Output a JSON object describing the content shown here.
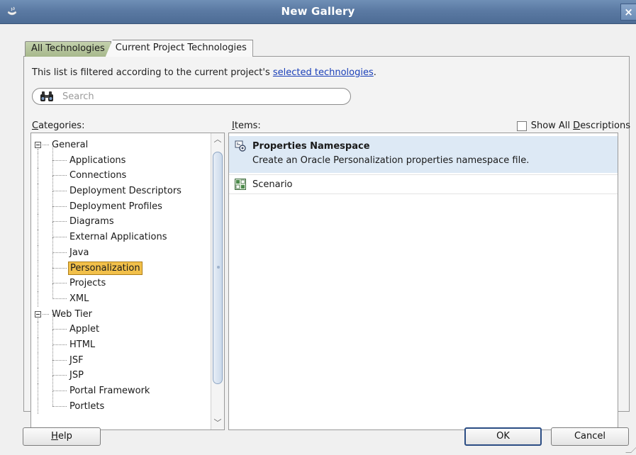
{
  "window": {
    "title": "New Gallery",
    "close_glyph": "×"
  },
  "tabs": [
    {
      "label": "All Technologies",
      "active": false
    },
    {
      "label": "Current Project Technologies",
      "active": true
    }
  ],
  "filter_note": {
    "text": "This list is filtered according to the current project's ",
    "link": "selected technologies",
    "suffix": "."
  },
  "search": {
    "placeholder": "Search",
    "value": "",
    "icon": "binoculars-icon"
  },
  "categories": {
    "label_mnemonic": "C",
    "label_rest": "ategories:",
    "tree": [
      {
        "label": "General",
        "level": 0,
        "expanded": true
      },
      {
        "label": "Applications",
        "level": 1
      },
      {
        "label": "Connections",
        "level": 1
      },
      {
        "label": "Deployment Descriptors",
        "level": 1
      },
      {
        "label": "Deployment Profiles",
        "level": 1
      },
      {
        "label": "Diagrams",
        "level": 1
      },
      {
        "label": "External Applications",
        "level": 1
      },
      {
        "label": "Java",
        "level": 1
      },
      {
        "label": "Personalization",
        "level": 1,
        "selected": true
      },
      {
        "label": "Projects",
        "level": 1
      },
      {
        "label": "XML",
        "level": 1
      },
      {
        "label": "Web Tier",
        "level": 0,
        "expanded": true
      },
      {
        "label": "Applet",
        "level": 1
      },
      {
        "label": "HTML",
        "level": 1
      },
      {
        "label": "JSF",
        "level": 1
      },
      {
        "label": "JSP",
        "level": 1
      },
      {
        "label": "Portal Framework",
        "level": 1
      },
      {
        "label": "Portlets",
        "level": 1
      }
    ]
  },
  "items": {
    "label_mnemonic": "I",
    "label_rest": "tems:",
    "show_all": {
      "before": "Show All ",
      "mnemonic": "D",
      "after": "escriptions",
      "checked": false
    },
    "list": [
      {
        "name": "Properties Namespace",
        "description": "Create an Oracle Personalization properties namespace file.",
        "selected": true,
        "icon": "properties-namespace-icon"
      },
      {
        "name": "Scenario",
        "description": "",
        "selected": false,
        "icon": "scenario-icon"
      }
    ]
  },
  "buttons": {
    "help_mnemonic": "H",
    "help_rest": "elp",
    "ok": "OK",
    "cancel": "Cancel"
  },
  "colors": {
    "titlebar": "#5b7aa3",
    "selection": "#f2c04a",
    "item_selection": "#dde9f5",
    "link": "#1a3fb8"
  }
}
